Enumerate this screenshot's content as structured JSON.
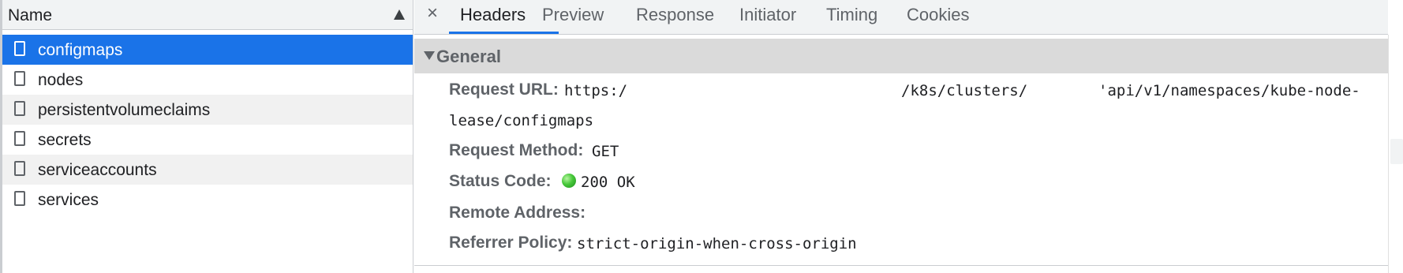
{
  "request_list": {
    "header_label": "Name",
    "items": [
      {
        "label": "configmaps",
        "selected": true
      },
      {
        "label": "nodes",
        "selected": false
      },
      {
        "label": "persistentvolumeclaims",
        "selected": false
      },
      {
        "label": "secrets",
        "selected": false
      },
      {
        "label": "serviceaccounts",
        "selected": false
      },
      {
        "label": "services",
        "selected": false
      }
    ]
  },
  "detail": {
    "close_glyph": "×",
    "tabs": [
      {
        "label": "Headers",
        "active": true
      },
      {
        "label": "Preview",
        "active": false
      },
      {
        "label": "Response",
        "active": false
      },
      {
        "label": "Initiator",
        "active": false
      },
      {
        "label": "Timing",
        "active": false
      },
      {
        "label": "Cookies",
        "active": false
      }
    ],
    "general": {
      "title": "General",
      "request_url_label": "Request URL:",
      "request_url_part1": "https:/",
      "request_url_part2": "/k8s/clusters/",
      "request_url_part3": "'api/v1/namespaces/kube-node-",
      "request_url_part4": "lease/configmaps",
      "request_method_label": "Request Method:",
      "request_method_value": "GET",
      "status_code_label": "Status Code:",
      "status_code_value": "200 OK",
      "remote_address_label": "Remote Address:",
      "referrer_policy_label": "Referrer Policy:",
      "referrer_policy_value": "strict-origin-when-cross-origin"
    }
  },
  "colors": {
    "selection": "#1a73e8",
    "status_ok": "#47c83a",
    "section_header_bg": "#dadada"
  }
}
